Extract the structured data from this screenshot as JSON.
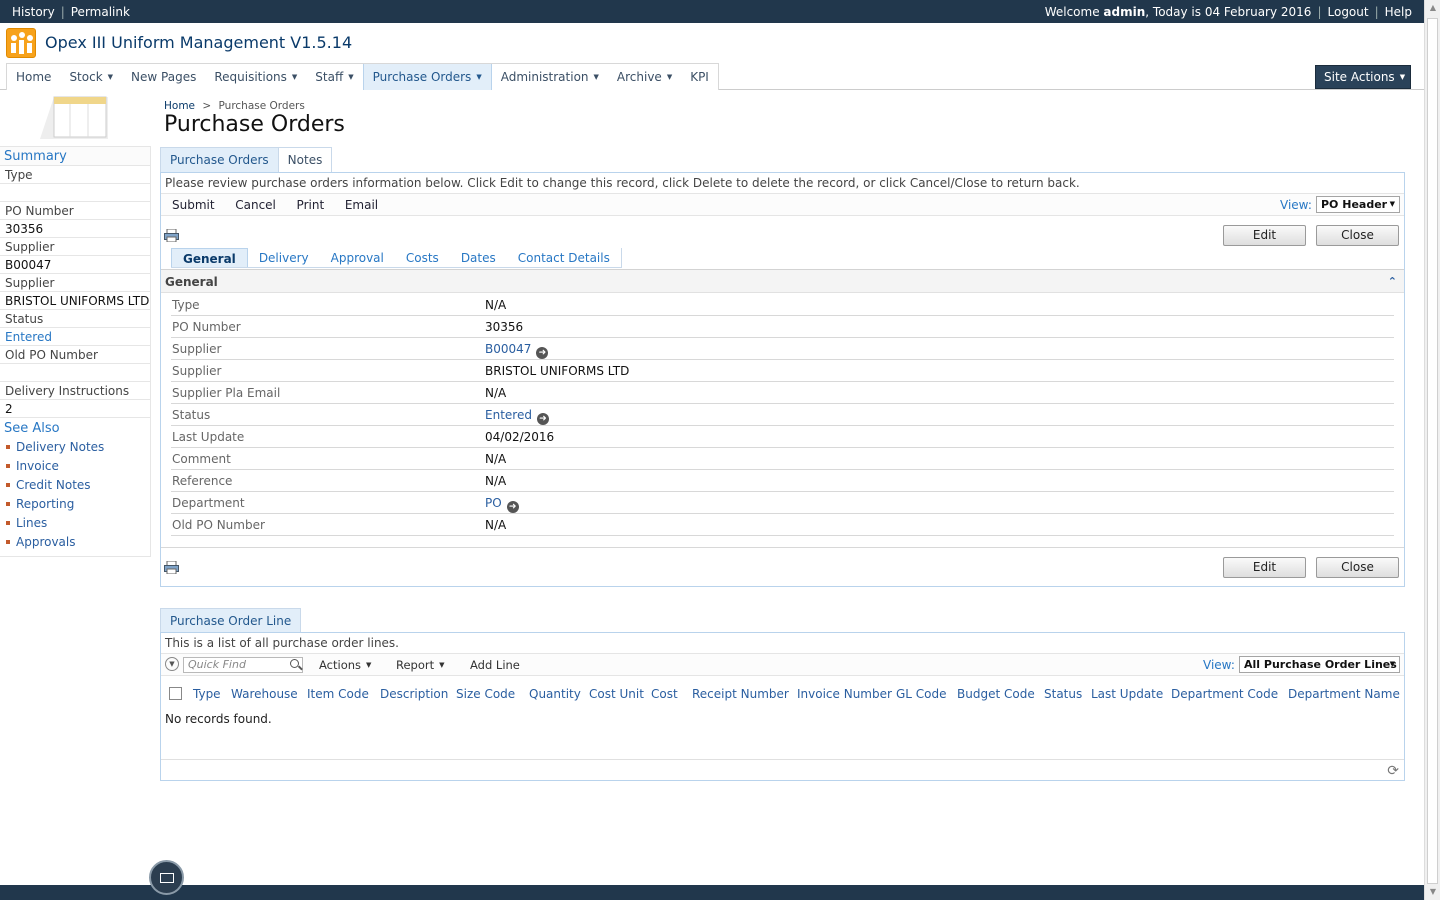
{
  "topbar": {
    "history": "History",
    "permalink": "Permalink",
    "welcome_prefix": "Welcome ",
    "user": "admin",
    "welcome_suffix": ", Today is 04 February 2016",
    "logout": "Logout",
    "help": "Help"
  },
  "app": {
    "title": "Opex III Uniform Management V1.5.14"
  },
  "nav": {
    "items": [
      "Home",
      "Stock",
      "New Pages",
      "Requisitions",
      "Staff",
      "Purchase Orders",
      "Administration",
      "Archive",
      "KPI"
    ],
    "site_actions": "Site Actions"
  },
  "breadcrumb": {
    "home": "Home",
    "sep": ">",
    "current": "Purchase Orders"
  },
  "page": {
    "title": "Purchase Orders"
  },
  "sidebar": {
    "summary": "Summary",
    "type_label": "Type",
    "po_label": "PO Number",
    "po_value": "30356",
    "supplier_label": "Supplier",
    "supplier_code": "B00047",
    "supplier_label2": "Supplier",
    "supplier_name": "BRISTOL UNIFORMS LTD",
    "status_label": "Status",
    "status_value": "Entered",
    "old_po_label": "Old PO Number",
    "delivery_label": "Delivery Instructions",
    "delivery_value": "2",
    "see_also": "See Also",
    "links": [
      "Delivery Notes",
      "Invoice",
      "Credit Notes",
      "Reporting",
      "Lines",
      "Approvals"
    ]
  },
  "tabs": {
    "main": [
      "Purchase Orders",
      "Notes"
    ]
  },
  "form": {
    "message": "Please review purchase orders information below. Click Edit to change this record, click Delete to delete the record, or click Cancel/Close to return back.",
    "toolbar": [
      "Submit",
      "Cancel",
      "Print",
      "Email"
    ],
    "view_label": "View:",
    "view_value": "PO Header",
    "edit": "Edit",
    "close": "Close",
    "subtabs": [
      "General",
      "Delivery",
      "Approval",
      "Costs",
      "Dates",
      "Contact Details"
    ],
    "section": "General",
    "rows": [
      {
        "k": "Type",
        "v": "N/A"
      },
      {
        "k": "PO Number",
        "v": "30356"
      },
      {
        "k": "Supplier",
        "v": "B00047"
      },
      {
        "k": "Supplier",
        "v": "BRISTOL UNIFORMS LTD"
      },
      {
        "k": "Supplier Pla Email",
        "v": "N/A"
      },
      {
        "k": "Status",
        "v": "Entered"
      },
      {
        "k": "Last Update",
        "v": "04/02/2016"
      },
      {
        "k": "Comment",
        "v": "N/A"
      },
      {
        "k": "Reference",
        "v": "N/A"
      },
      {
        "k": "Department",
        "v": "PO"
      },
      {
        "k": "Old PO Number",
        "v": "N/A"
      }
    ]
  },
  "lines": {
    "tab": "Purchase Order Line",
    "message": "This is a list of all purchase order lines.",
    "quickfind_placeholder": "Quick Find",
    "actions": "Actions",
    "report": "Report",
    "add_line": "Add Line",
    "view_label": "View:",
    "view_value": "All Purchase Order Lines",
    "columns": [
      "Type",
      "Warehouse",
      "Item Code",
      "Description",
      "Size Code",
      "Quantity",
      "Cost Unit",
      "Cost",
      "Receipt Number",
      "Invoice Number",
      "GL Code",
      "Budget Code",
      "Status",
      "Last Update",
      "Department Code",
      "Department Name"
    ],
    "empty": "No records found."
  }
}
